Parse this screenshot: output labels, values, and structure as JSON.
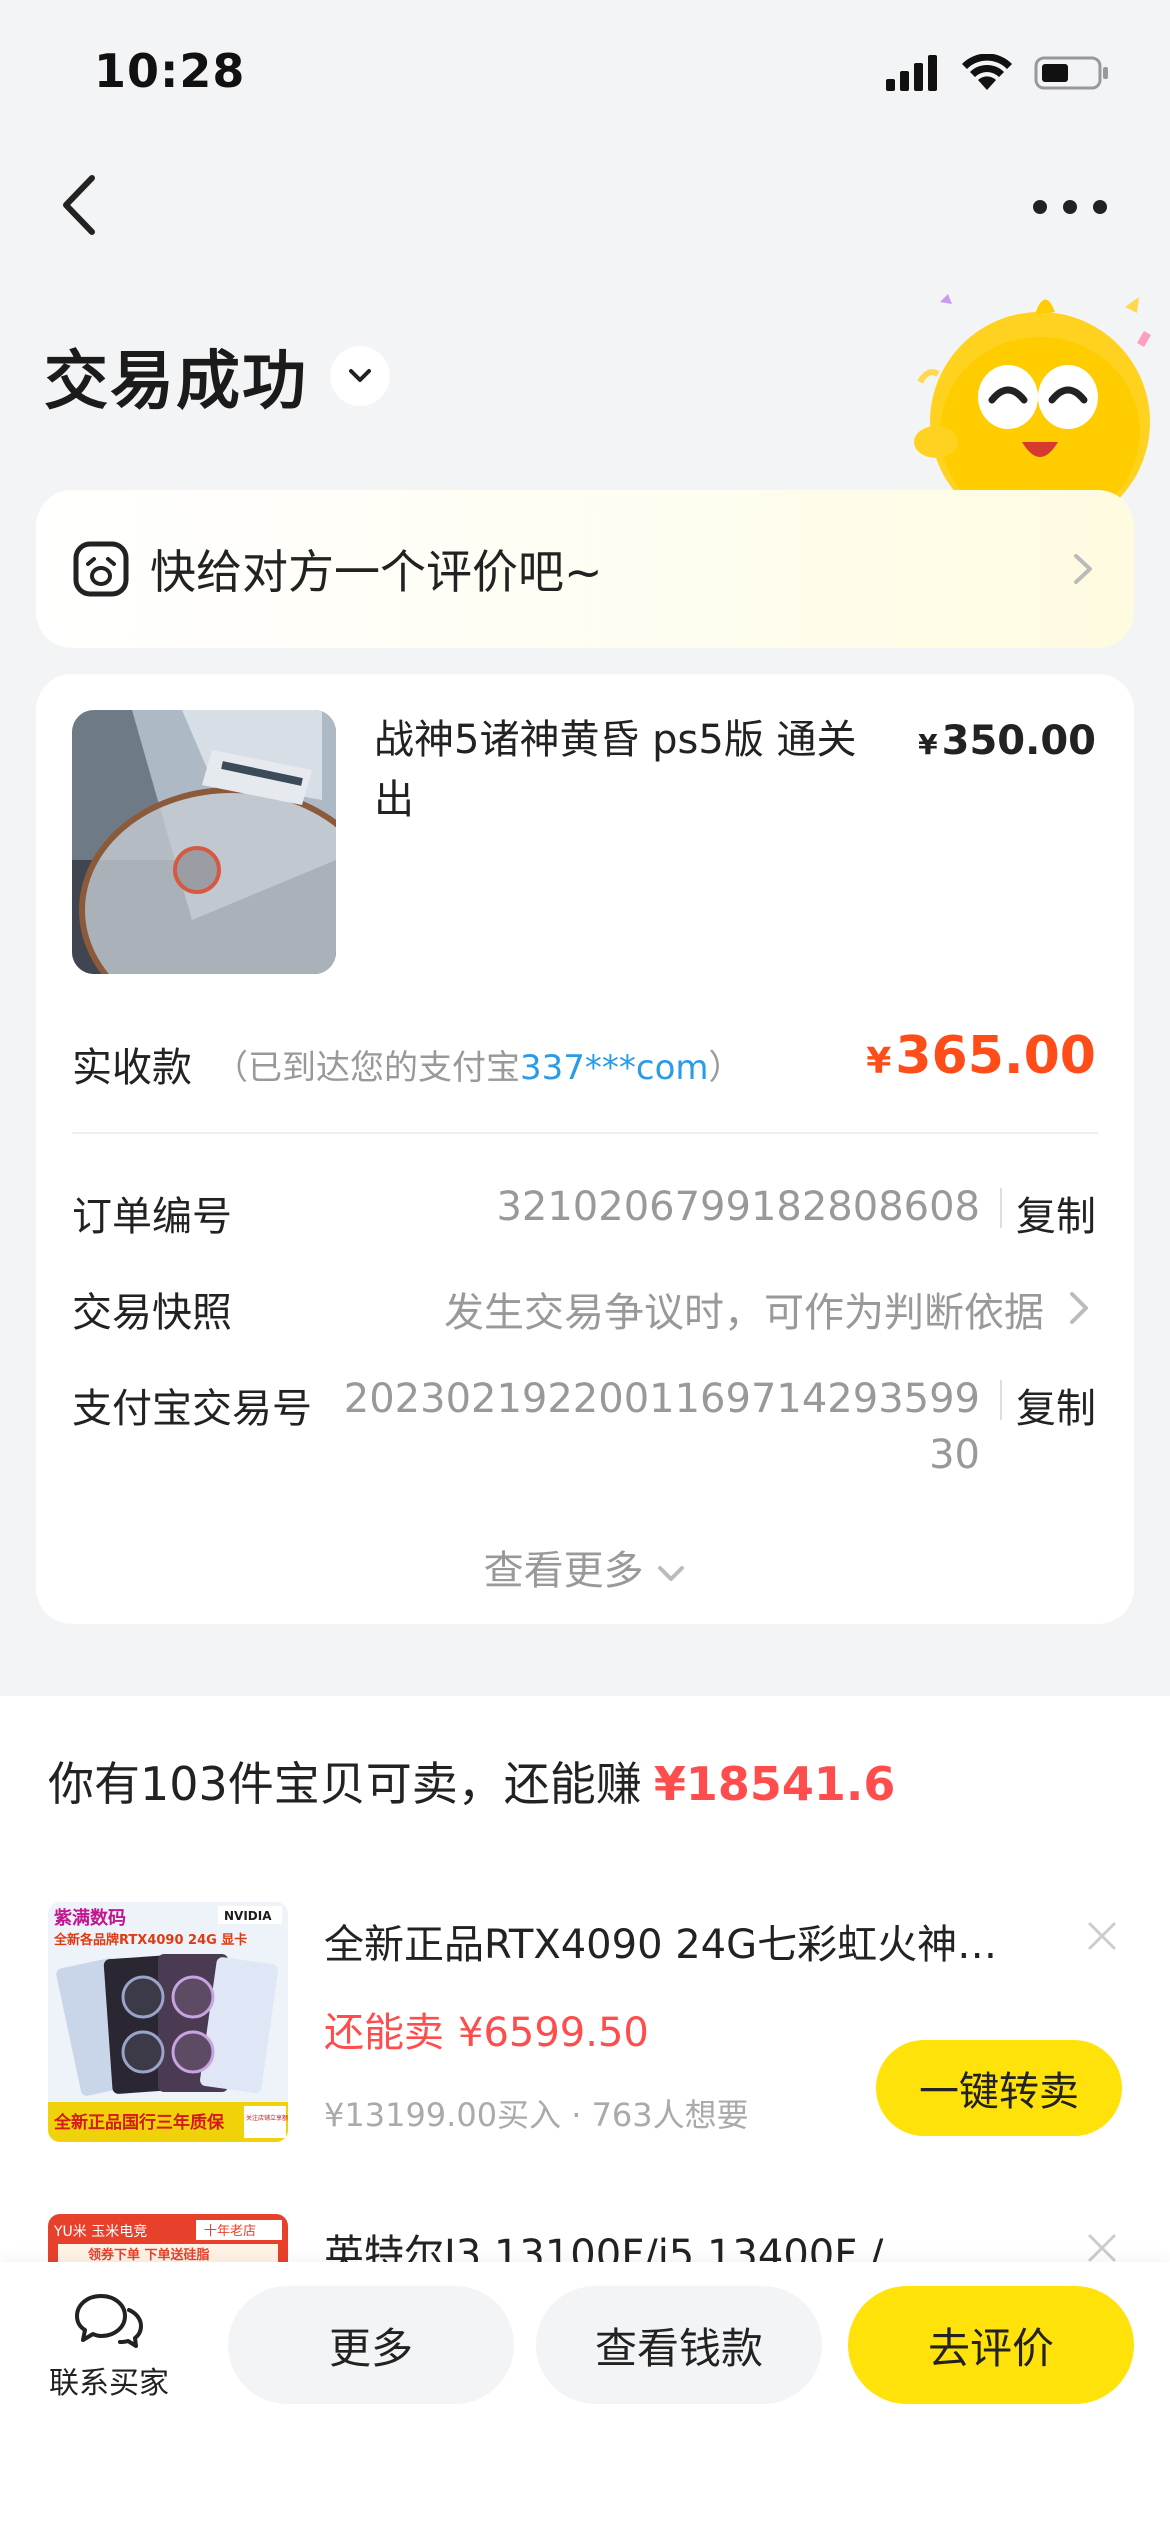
{
  "status_bar": {
    "time": "10:28"
  },
  "header": {
    "title": "交易成功"
  },
  "review_banner": {
    "text": "快给对方一个评价吧~"
  },
  "order": {
    "product_title": "战神5诸神黄昏 ps5版 通关出",
    "currency": "¥",
    "product_price": "350.00",
    "received_label": "实收款",
    "received_note_prefix": "（已到达您的支付宝",
    "received_account": "337***com",
    "received_note_suffix": "）",
    "received_amount": "365.00",
    "rows": [
      {
        "label": "订单编号",
        "value": "3210206799182808608",
        "action": "复制"
      },
      {
        "label": "交易快照",
        "value": "发生交易争议时，可作为判断依据"
      },
      {
        "label": "支付宝交易号",
        "value_line1": "2023021922001169714293599",
        "value_line2": "30",
        "action": "复制"
      }
    ],
    "see_more": "查看更多"
  },
  "resell": {
    "headline_prefix": "你有103件宝贝可卖，还能赚",
    "headline_amount": "¥18541.6",
    "items": [
      {
        "title": "全新正品RTX4090 24G七彩虹火神…",
        "sell_label": "还能卖",
        "sell_price": "¥6599.50",
        "meta": "¥13199.00买入 · 763人想要",
        "button": "一键转卖",
        "thumb_brand": "紫满数码",
        "thumb_line1": "全新各品牌RTX4090 24G 显卡",
        "thumb_nvidia": "NVIDIA",
        "thumb_footer": "全新正品国行三年质保",
        "thumb_tag": "关注店铺立享额外优惠"
      },
      {
        "title": "英特尔I3 13100F/i5 13400F /…",
        "thumb_brand": "YU米 玉米电竞",
        "thumb_tag": "十年老店",
        "thumb_line1": "领券下单 下单送硅脂"
      }
    ]
  },
  "bottom_bar": {
    "contact": "联系买家",
    "more": "更多",
    "view_payment": "查看钱款",
    "review": "去评价"
  },
  "colors": {
    "accent_yellow": "#ffe20a",
    "price_orange": "#ff4d1a",
    "price_red": "#ff4d4d",
    "link_blue": "#2a9be6"
  }
}
